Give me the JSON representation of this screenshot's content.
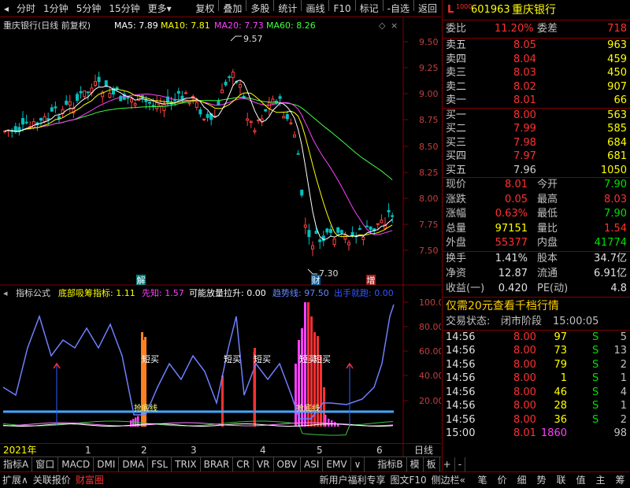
{
  "toolbar": {
    "items": [
      "分时",
      "1分钟",
      "5分钟",
      "15分钟",
      "更多"
    ],
    "right": [
      "复权",
      "叠加",
      "多股",
      "统计",
      "画线",
      "F10",
      "标记",
      "-自选",
      "返回"
    ]
  },
  "main_header": {
    "title": "重庆银行(日线 前复权)",
    "ma5": "MA5: 7.89",
    "ma10": "MA10: 7.81",
    "ma20": "MA20: 7.73",
    "ma60": "MA60: 8.26"
  },
  "price_axis": [
    "9.50",
    "9.25",
    "9.00",
    "8.75",
    "8.50",
    "8.25",
    "8.00",
    "7.75",
    "7.50"
  ],
  "annotations": {
    "high": "9.57",
    "low": "7.30",
    "jie": "解",
    "cai": "财",
    "zeng": "增"
  },
  "ind_header": {
    "name": "指标公式",
    "a": "底部吸筹指标: 1.11",
    "b": "先知: 1.57",
    "c": "可能放量拉升: 0.00",
    "d": "趋势线: 97.50",
    "e": "出手就跑: 0.00"
  },
  "ind_axis": [
    "100.0",
    "80.00",
    "60.00",
    "40.00",
    "20.00"
  ],
  "ind_labels": {
    "duanmai": "短买",
    "qudixian": "抢底线"
  },
  "date_axis": [
    "2021年",
    "1",
    "2",
    "3",
    "4",
    "5",
    "6"
  ],
  "date_right": "日线",
  "tabs": [
    "指标A",
    "窗口",
    "MACD",
    "DMI",
    "DMA",
    "FSL",
    "TRIX",
    "BRAR",
    "CR",
    "VR",
    "OBV",
    "ASI",
    "EMV",
    "∨",
    "指标B",
    "模",
    "板",
    "+",
    "-"
  ],
  "stock": {
    "code": "601963",
    "name": "重庆银行"
  },
  "wb": {
    "label": "委比",
    "val": "11.20%",
    "label2": "委差",
    "val2": "718"
  },
  "asks": [
    [
      "卖五",
      "8.05",
      "963"
    ],
    [
      "卖四",
      "8.04",
      "459"
    ],
    [
      "卖三",
      "8.03",
      "450"
    ],
    [
      "卖二",
      "8.02",
      "907"
    ],
    [
      "卖一",
      "8.01",
      "66"
    ]
  ],
  "bids": [
    [
      "买一",
      "8.00",
      "563"
    ],
    [
      "买二",
      "7.99",
      "585"
    ],
    [
      "买三",
      "7.98",
      "684"
    ],
    [
      "买四",
      "7.97",
      "681"
    ],
    [
      "买五",
      "7.96",
      "1050"
    ]
  ],
  "quote": [
    [
      "现价",
      "8.01",
      "今开",
      "7.90"
    ],
    [
      "涨跌",
      "0.05",
      "最高",
      "8.03"
    ],
    [
      "涨幅",
      "0.63%",
      "最低",
      "7.90"
    ],
    [
      "总量",
      "97151",
      "量比",
      "1.54"
    ],
    [
      "外盘",
      "55377",
      "内盘",
      "41774"
    ]
  ],
  "fin": [
    [
      "换手",
      "1.41%",
      "股本",
      "34.7亿"
    ],
    [
      "净资",
      "12.87",
      "流通",
      "6.91亿"
    ],
    [
      "收益(一)",
      "0.420",
      "PE(动)",
      "4.8"
    ]
  ],
  "promo": "仅需20元查看千档行情",
  "status": {
    "label": "交易状态:",
    "state": "闭市阶段",
    "time": "15:00:05"
  },
  "ticks": [
    [
      "14:56",
      "8.00",
      "97",
      "S",
      "5"
    ],
    [
      "14:56",
      "8.00",
      "73",
      "S",
      "13"
    ],
    [
      "14:56",
      "8.00",
      "79",
      "S",
      "2"
    ],
    [
      "14:56",
      "8.00",
      "1",
      "S",
      "1"
    ],
    [
      "14:56",
      "8.00",
      "46",
      "S",
      "4"
    ],
    [
      "14:56",
      "8.00",
      "28",
      "S",
      "1"
    ],
    [
      "14:56",
      "8.00",
      "36",
      "S",
      "2"
    ],
    [
      "15:00",
      "8.01",
      "1860",
      "",
      "98"
    ]
  ],
  "bottom": [
    "扩展∧",
    "关联报价",
    "财富圈",
    "新用户福利专享",
    "图文F10",
    "侧边栏«",
    "笔",
    "价",
    "细",
    "势",
    "联",
    "值",
    "主",
    "筹"
  ]
}
